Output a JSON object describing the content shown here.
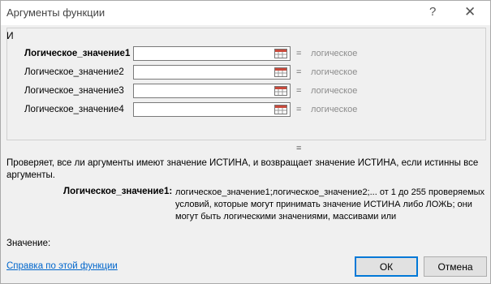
{
  "window": {
    "title": "Аргументы функции",
    "help_label": "?",
    "close_label": "✕"
  },
  "function": {
    "name": "И"
  },
  "args": [
    {
      "label": "Логическое_значение1",
      "value": "",
      "eq": "=",
      "result": "логическое",
      "active": true
    },
    {
      "label": "Логическое_значение2",
      "value": "",
      "eq": "=",
      "result": "логическое",
      "active": false
    },
    {
      "label": "Логическое_значение3",
      "value": "",
      "eq": "=",
      "result": "логическое",
      "active": false
    },
    {
      "label": "Логическое_значение4",
      "value": "",
      "eq": "=",
      "result": "логическое",
      "active": false
    }
  ],
  "result_eq": "=",
  "description": "Проверяет, все ли аргументы имеют значение ИСТИНА, и возвращает значение ИСТИНА, если истинны все аргументы.",
  "arg_help": {
    "name": "Логическое_значение1:",
    "text": "логическое_значение1;логическое_значение2;... от 1 до 255 проверяемых условий, которые могут принимать значение ИСТИНА либо ЛОЖЬ; они могут быть логическими значениями, массивами или"
  },
  "value_label": "Значение:",
  "help_link": "Справка по этой функции",
  "buttons": {
    "ok": "ОК",
    "cancel": "Отмена"
  },
  "icons": {
    "collapse": "range-select-icon"
  },
  "colors": {
    "focus_border": "#0078d7",
    "link": "#0066cc",
    "result_text": "#8c8c8c"
  }
}
